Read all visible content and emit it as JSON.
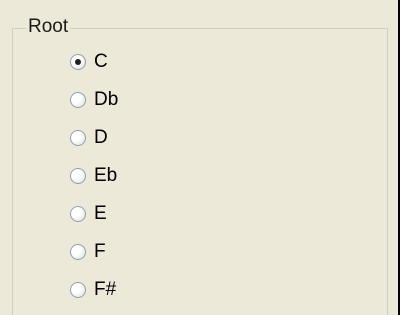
{
  "root_group": {
    "title": "Root",
    "options": [
      {
        "label": "C",
        "selected": true
      },
      {
        "label": "Db",
        "selected": false
      },
      {
        "label": "D",
        "selected": false
      },
      {
        "label": "Eb",
        "selected": false
      },
      {
        "label": "E",
        "selected": false
      },
      {
        "label": "F",
        "selected": false
      },
      {
        "label": "F#",
        "selected": false
      }
    ]
  }
}
